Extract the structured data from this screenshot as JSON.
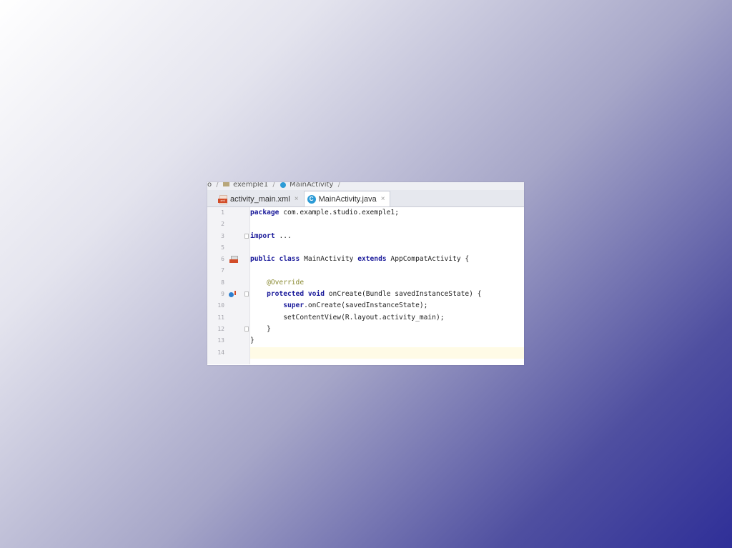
{
  "breadcrumbs": {
    "items": [
      "o",
      "exemple1",
      "MainActivity"
    ],
    "separator": "/"
  },
  "tabs": [
    {
      "label": "activity_main.xml",
      "icon": "xml-file-icon",
      "active": false,
      "close": "×"
    },
    {
      "label": "MainActivity.java",
      "icon": "java-class-icon",
      "active": true,
      "close": "×"
    }
  ],
  "editor": {
    "current_line": 14,
    "lines": [
      {
        "n": "1",
        "code": "package com.example.studio.exemple1;"
      },
      {
        "n": "2",
        "code": ""
      },
      {
        "n": "3",
        "code": "import ..."
      },
      {
        "n": "5",
        "code": ""
      },
      {
        "n": "6",
        "code": "public class MainActivity extends AppCompatActivity {"
      },
      {
        "n": "7",
        "code": ""
      },
      {
        "n": "8",
        "code": "    @Override"
      },
      {
        "n": "9",
        "code": "    protected void onCreate(Bundle savedInstanceState) {"
      },
      {
        "n": "10",
        "code": "        super.onCreate(savedInstanceState);"
      },
      {
        "n": "11",
        "code": "        setContentView(R.layout.activity_main);"
      },
      {
        "n": "12",
        "code": "    }"
      },
      {
        "n": "13",
        "code": "}"
      },
      {
        "n": "14",
        "code": ""
      }
    ]
  },
  "colors": {
    "keyword": "#1a1a9a",
    "annotation": "#8a8a32",
    "class_icon": "#2c9bd6",
    "xml_badge": "#d24c28"
  }
}
